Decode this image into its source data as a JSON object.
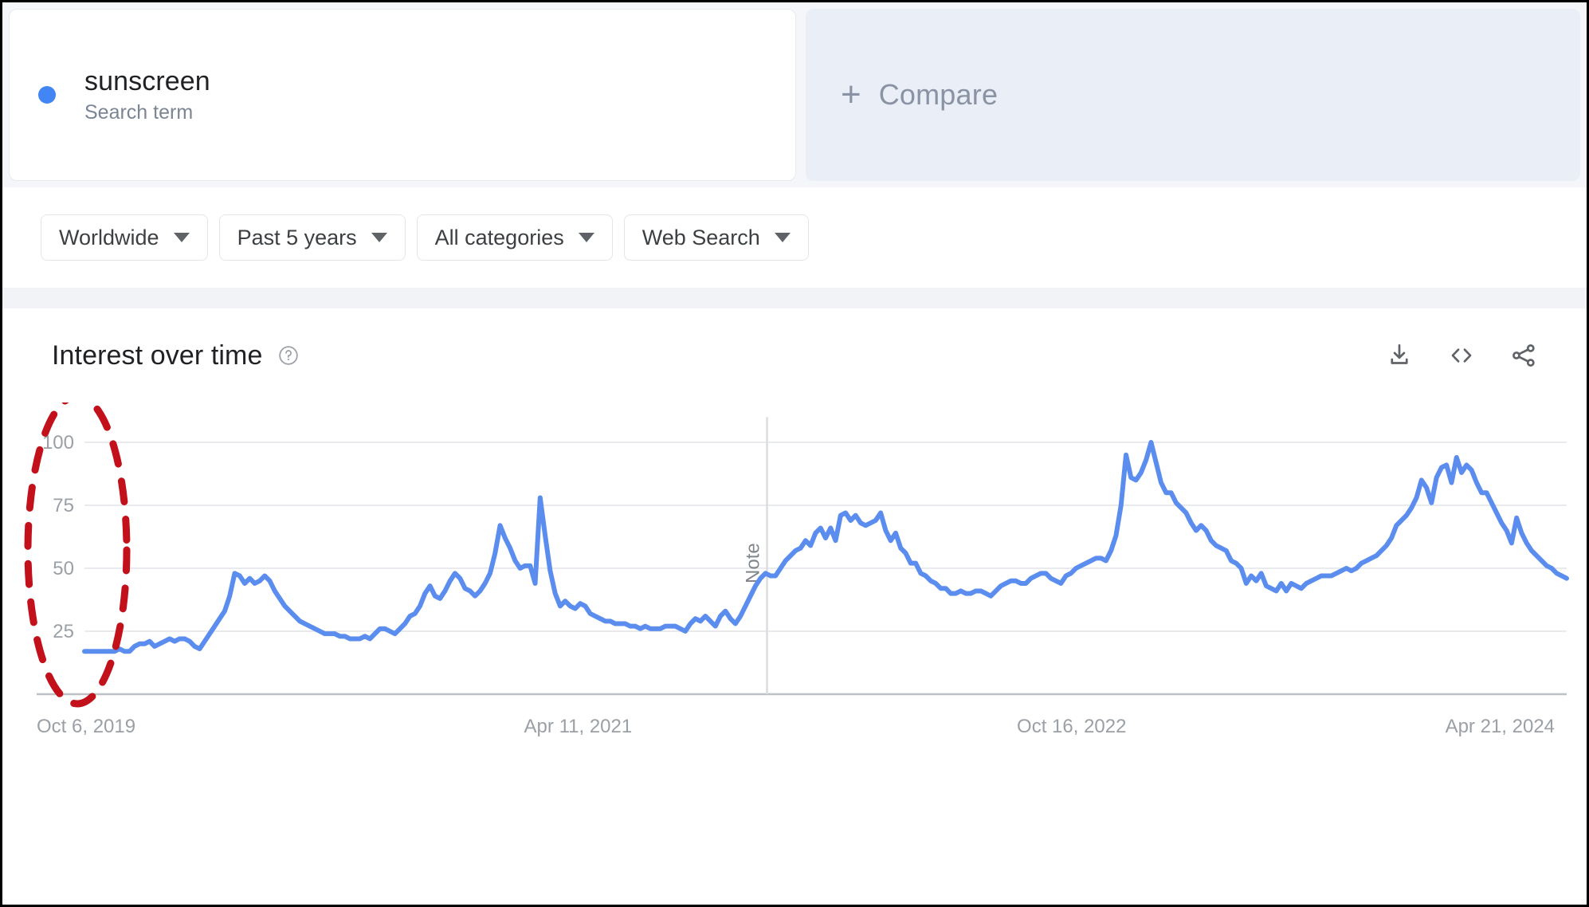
{
  "search_term": {
    "dot_color": "#4285f4",
    "title": "sunscreen",
    "subtitle": "Search term"
  },
  "compare": {
    "plus": "+",
    "label": "Compare"
  },
  "filters": [
    {
      "label": "Worldwide",
      "icon": "chevron-down-icon"
    },
    {
      "label": "Past 5 years",
      "icon": "chevron-down-icon"
    },
    {
      "label": "All categories",
      "icon": "chevron-down-icon"
    },
    {
      "label": "Web Search",
      "icon": "chevron-down-icon"
    }
  ],
  "chart_panel": {
    "title": "Interest over time",
    "help_icon": "help-circle-icon",
    "actions": [
      {
        "name": "download-icon",
        "tooltip": "Download"
      },
      {
        "name": "embed-code-icon",
        "tooltip": "Embed"
      },
      {
        "name": "share-icon",
        "tooltip": "Share"
      }
    ]
  },
  "annotation": {
    "shape": "dashed-ellipse",
    "color": "#c2111b",
    "target": "y-axis-tick-labels"
  },
  "chart_data": {
    "type": "line",
    "title": "Interest over time",
    "xlabel": "",
    "ylabel": "",
    "ylim": [
      0,
      110
    ],
    "yticks": [
      25,
      50,
      75,
      100
    ],
    "ytick_labels": [
      "25",
      "50",
      "75",
      "100"
    ],
    "xtick_labels": [
      "Oct 6, 2019",
      "Apr 11, 2021",
      "Oct 16, 2022",
      "Apr 21, 2024"
    ],
    "xtick_positions": [
      0,
      0.333,
      0.666,
      0.955
    ],
    "grid": true,
    "legend": false,
    "series_name": "sunscreen",
    "series_color": "#5b8def",
    "annotations": [
      {
        "label": "Note",
        "x_fraction": 0.4605,
        "orientation": "vertical"
      }
    ],
    "values": [
      17,
      17,
      17,
      17,
      17,
      17,
      17,
      18,
      17,
      17,
      19,
      20,
      20,
      21,
      19,
      20,
      21,
      22,
      21,
      22,
      22,
      21,
      19,
      18,
      21,
      24,
      27,
      30,
      33,
      39,
      48,
      47,
      44,
      46,
      44,
      45,
      47,
      45,
      41,
      38,
      35,
      33,
      31,
      29,
      28,
      27,
      26,
      25,
      24,
      24,
      24,
      23,
      23,
      22,
      22,
      22,
      23,
      22,
      24,
      26,
      26,
      25,
      24,
      26,
      28,
      31,
      32,
      35,
      40,
      43,
      39,
      38,
      41,
      45,
      48,
      46,
      42,
      41,
      39,
      41,
      44,
      48,
      56,
      67,
      62,
      58,
      53,
      50,
      51,
      51,
      44,
      78,
      63,
      49,
      40,
      35,
      37,
      35,
      34,
      36,
      35,
      32,
      31,
      30,
      29,
      29,
      28,
      28,
      28,
      27,
      27,
      26,
      27,
      26,
      26,
      26,
      27,
      27,
      27,
      26,
      25,
      28,
      30,
      29,
      31,
      29,
      27,
      31,
      33,
      30,
      28,
      31,
      35,
      39,
      43,
      46,
      48,
      47,
      47,
      50,
      53,
      55,
      57,
      58,
      61,
      59,
      64,
      66,
      62,
      66,
      61,
      71,
      72,
      69,
      71,
      68,
      67,
      68,
      69,
      72,
      65,
      61,
      64,
      58,
      56,
      52,
      52,
      48,
      47,
      45,
      44,
      42,
      42,
      40,
      40,
      41,
      40,
      40,
      41,
      41,
      40,
      39,
      41,
      43,
      44,
      45,
      45,
      44,
      44,
      46,
      47,
      48,
      48,
      46,
      45,
      44,
      47,
      48,
      50,
      51,
      52,
      53,
      54,
      54,
      53,
      57,
      63,
      75,
      95,
      86,
      85,
      88,
      93,
      100,
      92,
      84,
      80,
      80,
      76,
      74,
      72,
      68,
      65,
      67,
      65,
      61,
      59,
      58,
      57,
      53,
      52,
      50,
      44,
      47,
      45,
      48,
      43,
      42,
      41,
      44,
      41,
      44,
      43,
      42,
      44,
      45,
      46,
      47,
      47,
      47,
      48,
      49,
      50,
      49,
      50,
      52,
      53,
      54,
      55,
      57,
      59,
      62,
      67,
      69,
      71,
      74,
      78,
      85,
      82,
      76,
      86,
      90,
      91,
      84,
      94,
      88,
      91,
      89,
      84,
      80,
      80,
      76,
      72,
      68,
      65,
      60,
      70,
      64,
      60,
      57,
      55,
      53,
      51,
      50,
      48,
      47,
      46
    ]
  }
}
